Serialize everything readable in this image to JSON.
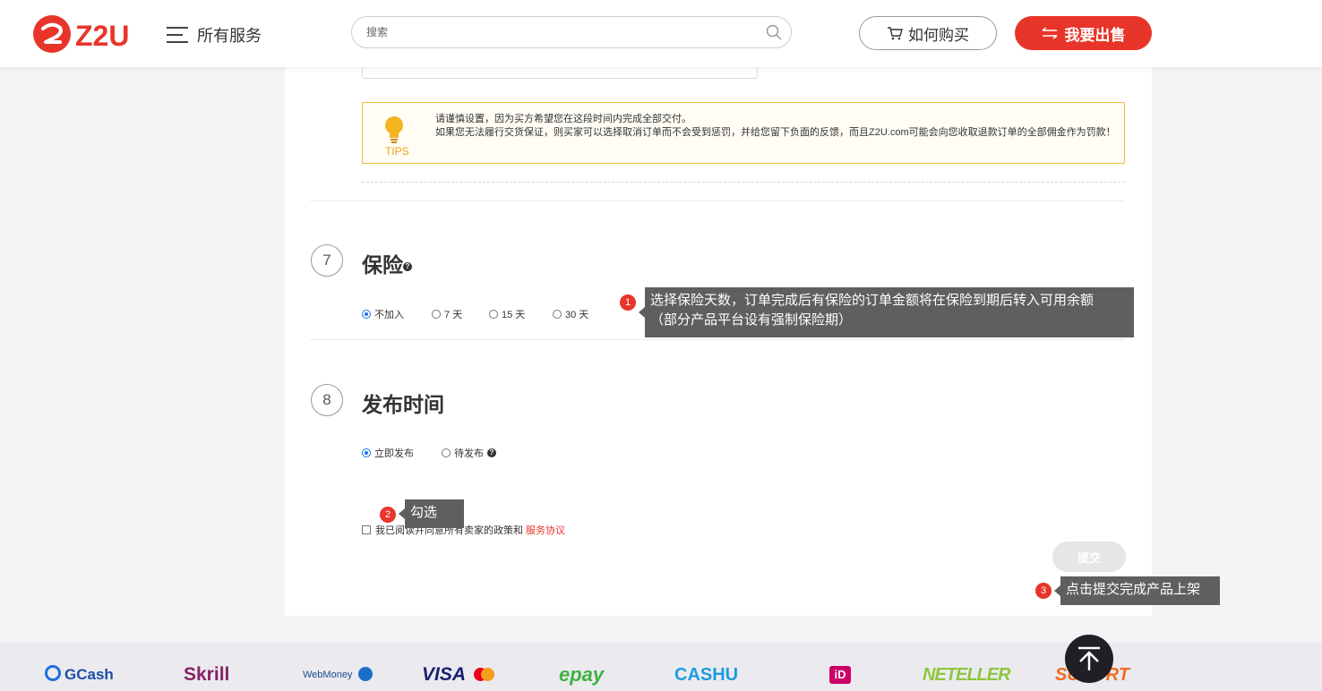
{
  "header": {
    "logo_text": "Z2U",
    "menu_label": "所有服务",
    "search_placeholder": "搜索",
    "how_to_buy_label": "如何购买",
    "sell_label": "我要出售"
  },
  "tips": {
    "label": "TIPS",
    "line1": "请谨慎设置，因为买方希望您在这段时间内完成全部交付。",
    "line2": "如果您无法履行交货保证，则买家可以选择取消订单而不会受到惩罚，并给您留下负面的反馈，而且Z2U.com可能会向您收取退款订单的全部佣金作为罚款！"
  },
  "insurance": {
    "step": "7",
    "title": "保险",
    "options": [
      "不加入",
      "7 天",
      "15 天",
      "30 天"
    ],
    "selected": "不加入"
  },
  "publish": {
    "step": "8",
    "title": "发布时间",
    "options": [
      "立即发布",
      "待发布"
    ],
    "selected": "立即发布"
  },
  "agreement": {
    "text": "我已阅读并同意所有卖家的政策和",
    "link": "服务协议",
    "checked": false
  },
  "submit_label": "提交",
  "annotations": [
    {
      "number": "1",
      "text_line1": "选择保险天数，订单完成后有保险的订单金额将在保险到期后转入可用余额",
      "text_line2": "（部分产品平台设有强制保险期）"
    },
    {
      "number": "2",
      "text": "勾选"
    },
    {
      "number": "3",
      "text": "点击提交完成产品上架"
    }
  ],
  "payments": [
    "GCash",
    "Skrill",
    "WebMoney",
    "VISA",
    "epay",
    "CASHU",
    "iD",
    "NETELLER",
    "SUPORT"
  ],
  "colors": {
    "accent": "#e8352a",
    "tips_border": "#f1b93b",
    "tooltip_bg": "#5f5f5f",
    "radio_checked": "#1a73e8"
  }
}
